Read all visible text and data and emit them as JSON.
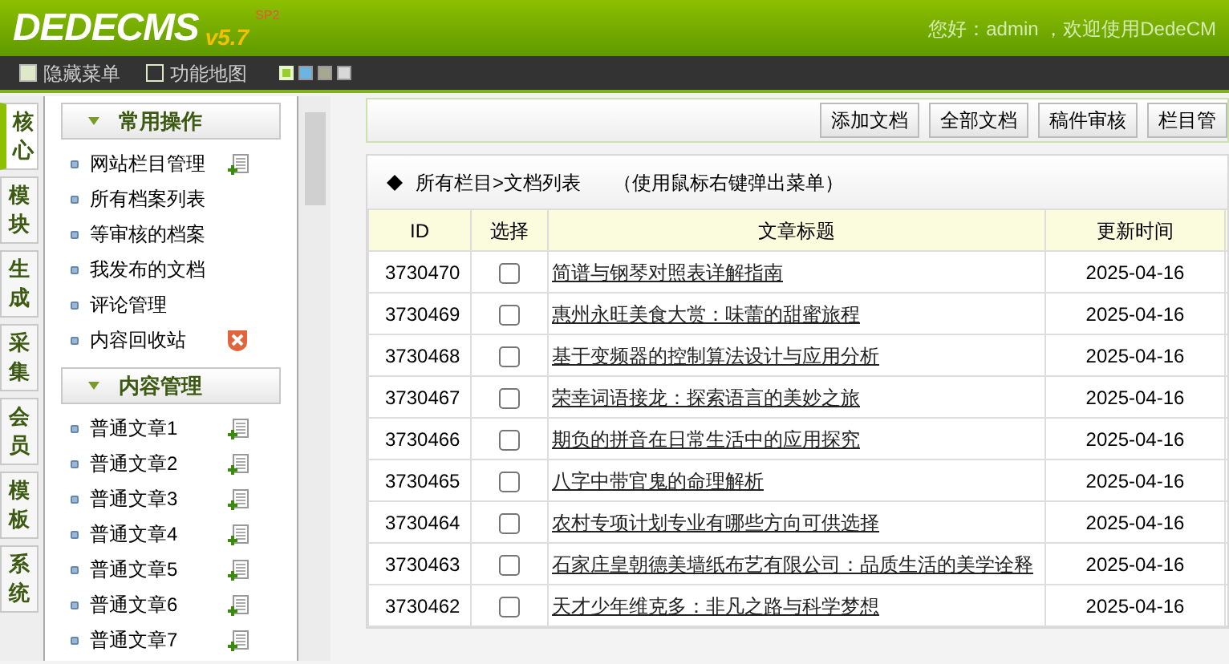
{
  "header": {
    "logo": "DEDECMS",
    "version": "v5.7",
    "edition": "SP2",
    "greeting": "您好：admin ，欢迎使用DedeCM"
  },
  "toolbar": {
    "links": [
      {
        "label": "隐藏菜单",
        "kind": "hide"
      },
      {
        "label": "功能地图",
        "kind": "map"
      }
    ],
    "skins": [
      {
        "color": "#9acd32",
        "selected": true
      },
      {
        "color": "#6cb4e4",
        "selected": false
      },
      {
        "color": "#a8a890",
        "selected": false
      },
      {
        "color": "#d8d8d8",
        "selected": false
      }
    ]
  },
  "side_tabs": [
    {
      "label": "核心",
      "selected": true
    },
    {
      "label": "模块",
      "selected": false
    },
    {
      "label": "生成",
      "selected": false
    },
    {
      "label": "采集",
      "selected": false
    },
    {
      "label": "会员",
      "selected": false
    },
    {
      "label": "模板",
      "selected": false
    },
    {
      "label": "系统",
      "selected": false
    }
  ],
  "menu": [
    {
      "title": "常用操作",
      "items": [
        {
          "label": "网站栏目管理",
          "kind": "add"
        },
        {
          "label": "所有档案列表",
          "kind": "plain"
        },
        {
          "label": "等审核的档案",
          "kind": "plain"
        },
        {
          "label": "我发布的文档",
          "kind": "plain"
        },
        {
          "label": "评论管理",
          "kind": "plain"
        },
        {
          "label": "内容回收站",
          "kind": "delete"
        }
      ]
    },
    {
      "title": "内容管理",
      "items": [
        {
          "label": "普通文章1",
          "kind": "add"
        },
        {
          "label": "普通文章2",
          "kind": "add"
        },
        {
          "label": "普通文章3",
          "kind": "add"
        },
        {
          "label": "普通文章4",
          "kind": "add"
        },
        {
          "label": "普通文章5",
          "kind": "add"
        },
        {
          "label": "普通文章6",
          "kind": "add"
        },
        {
          "label": "普通文章7",
          "kind": "add"
        }
      ]
    }
  ],
  "buttons": [
    "添加文档",
    "全部文档",
    "稿件审核",
    "栏目管"
  ],
  "breadcrumb": {
    "path": "所有栏目>文档列表",
    "hint": "（使用鼠标右键弹出菜单）"
  },
  "table": {
    "columns": [
      "ID",
      "选择",
      "文章标题",
      "更新时间"
    ],
    "rows": [
      {
        "id": "3730470",
        "checked": false,
        "title": "简谱与钢琴对照表详解指南",
        "date": "2025-04-16"
      },
      {
        "id": "3730469",
        "checked": false,
        "title": "惠州永旺美食大赏：味蕾的甜蜜旅程",
        "date": "2025-04-16"
      },
      {
        "id": "3730468",
        "checked": false,
        "title": "基于变频器的控制算法设计与应用分析",
        "date": "2025-04-16"
      },
      {
        "id": "3730467",
        "checked": false,
        "title": "荣幸词语接龙：探索语言的美妙之旅",
        "date": "2025-04-16"
      },
      {
        "id": "3730466",
        "checked": false,
        "title": "期负的拼音在日常生活中的应用探究",
        "date": "2025-04-16"
      },
      {
        "id": "3730465",
        "checked": false,
        "title": "八字中带官鬼的命理解析",
        "date": "2025-04-16"
      },
      {
        "id": "3730464",
        "checked": false,
        "title": "农村专项计划专业有哪些方向可供选择",
        "date": "2025-04-16"
      },
      {
        "id": "3730463",
        "checked": false,
        "title": "石家庄皇朝德美墙纸布艺有限公司：品质生活的美学诠释",
        "date": "2025-04-16"
      },
      {
        "id": "3730462",
        "checked": false,
        "title": "天才少年维克多：非凡之路与科学梦想",
        "date": "2025-04-16"
      }
    ]
  }
}
